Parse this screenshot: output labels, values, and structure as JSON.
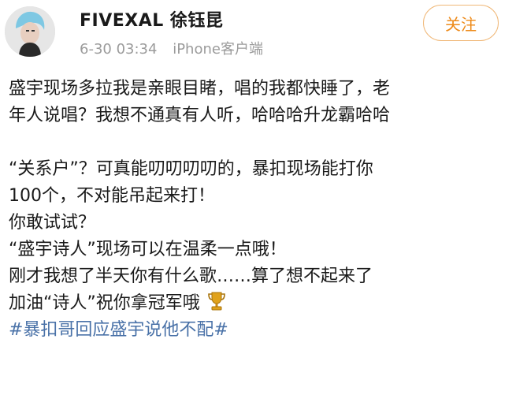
{
  "user": {
    "name": "FIVEXAL 徐钰昆",
    "avatar_icon": "user-avatar",
    "time": "6-30 03:34",
    "source": "iPhone客户端"
  },
  "follow_button": {
    "label": "关注"
  },
  "post": {
    "lines": [
      "盛宇现场多拉我是亲眼目睹，唱的我都快睡了，老",
      "年人说唱？我想不通真有人听，哈哈哈升龙霸哈哈",
      "",
      "“关系户”？可真能叨叨叨叨的，暴扣现场能打你",
      "100个，不对能吊起来打！",
      "你敢试试？",
      "“盛宇诗人”现场可以在温柔一点哦！",
      "刚才我想了半天你有什么歌……算了想不起来了",
      "加油“诗人”祝你拿冠军哦"
    ],
    "trophy_icon": "trophy-icon",
    "hashtag": "#暴扣哥回应盛宇说他不配#"
  },
  "colors": {
    "follow_accent": "#ee8a19",
    "hashtag": "#4a72a8",
    "meta_text": "#9b9b9b"
  }
}
